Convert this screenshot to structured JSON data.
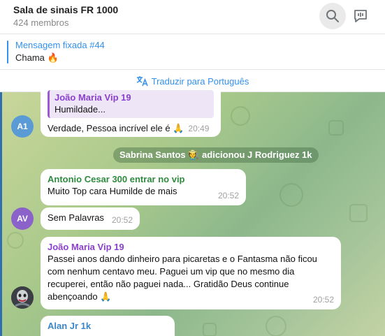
{
  "header": {
    "title": "Sala de sinais FR 1000",
    "members": "424 membros",
    "icons": [
      "search-icon",
      "chat-icon",
      "more-icon"
    ]
  },
  "pinned": {
    "title": "Mensagem fixada #44",
    "text": "Chama 🔥"
  },
  "translate": {
    "label": "Traduzir para Português"
  },
  "messages": [
    {
      "reply_name": "João Maria Vip 19",
      "reply_text": "Humildade...",
      "text": "Verdade, Pessoa incrível ele é 🙏",
      "time": "20:49",
      "avatar": "A1"
    },
    {
      "service": "Sabrina Santos 🧑‍🌾 adicionou J Rodriguez 1k"
    },
    {
      "sender": "Antonio Cesar 300 entrar no vip",
      "text": "Muito Top cara Humilde de mais",
      "time": "20:52"
    },
    {
      "text": "Sem Palavras",
      "time": "20:52",
      "avatar": "AV"
    },
    {
      "sender": "João Maria Vip 19",
      "lines": [
        "Passei anos dando dinheiro para picaretas e o Fantasma não ficou",
        "com nenhum centavo meu. Paguei um vip que no mesmo dia",
        "recuperei, então não paguei nada... Gratidão Deus continue",
        "abençoando 🙏"
      ],
      "time": "20:52"
    },
    {
      "sender": "Alan Jr 1k"
    }
  ],
  "colors": {
    "accent": "#3390ec",
    "avatar_a1": "#5b9bd5",
    "avatar_av": "#8a62c9",
    "sender_purple": "#8a3fcf",
    "sender_green": "#2e8b3e",
    "sender_blue": "#3a86c8"
  }
}
